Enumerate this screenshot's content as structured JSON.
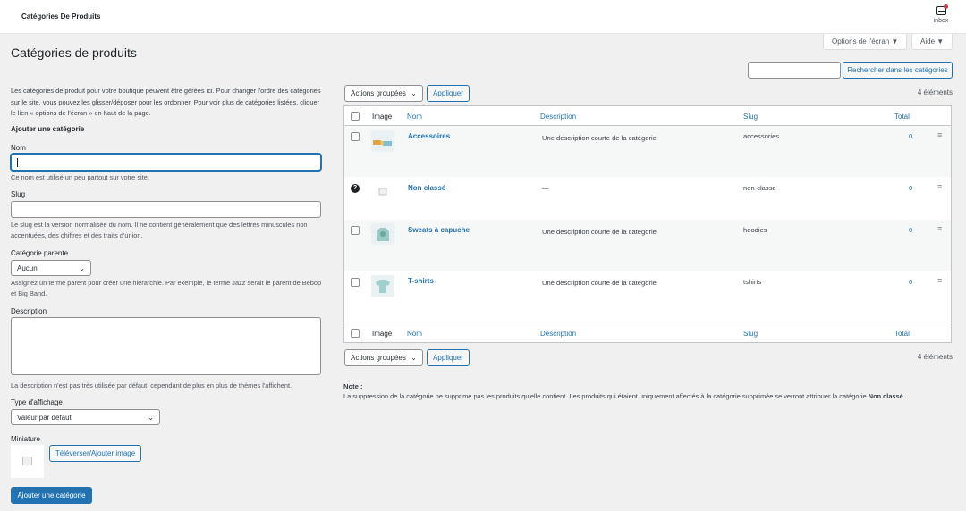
{
  "topbar": {
    "title": "Catégories De Produits",
    "inbox_label": "inbox"
  },
  "screen_options": {
    "label": "Options de l'écran ▼",
    "help_label": "Aide ▼"
  },
  "page": {
    "title": "Catégories de produits"
  },
  "search": {
    "button": "Rechercher dans les catégories",
    "value": ""
  },
  "form": {
    "intro": "Les catégories de produit pour votre boutique peuvent être gérées ici. Pour changer l'ordre des catégories sur le site, vous pouvez les glisser/déposer pour les ordonner. Pour voir plus de catégories listées, cliquer le lien « options de l'écran » en haut de la page.",
    "heading": "Ajouter une catégorie",
    "name_label": "Nom",
    "name_value": "",
    "name_help": "Ce nom est utilisé un peu partout sur votre site.",
    "slug_label": "Slug",
    "slug_value": "",
    "slug_help": "Le slug est la version normalisée du nom. Il ne contient généralement que des lettres minuscules non accentuées, des chiffres et des traits d'union.",
    "parent_label": "Catégorie parente",
    "parent_value": "Aucun",
    "parent_help": "Assignez un terme parent pour créer une hiérarchie. Par exemple, le terme Jazz serait le parent de Bebop et Big Band.",
    "description_label": "Description",
    "description_value": "",
    "description_help": "La description n'est pas très utilisée par défaut, cependant de plus en plus de thèmes l'affichent.",
    "display_label": "Type d'affichage",
    "display_value": "Valeur par défaut",
    "thumbnail_label": "Miniature",
    "upload_button": "Téléverser/Ajouter image",
    "submit_button": "Ajouter une catégorie"
  },
  "bulk": {
    "actions_label": "Actions groupées",
    "apply_label": "Appliquer",
    "count_text": "4 éléments"
  },
  "table": {
    "columns": {
      "image": "Image",
      "name": "Nom",
      "description": "Description",
      "slug": "Slug",
      "total": "Total"
    },
    "rows": [
      {
        "name": "Accessoires",
        "description": "Une description courte de la catégorie",
        "slug": "accessories",
        "count": "0"
      },
      {
        "name": "Non classé",
        "description": "—",
        "slug": "non-classe",
        "count": "0"
      },
      {
        "name": "Sweats à capuche",
        "description": "Une description courte de la catégorie",
        "slug": "hoodies",
        "count": "0"
      },
      {
        "name": "T-shirts",
        "description": "Une description courte de la catégorie",
        "slug": "tshirts",
        "count": "0"
      }
    ]
  },
  "note": {
    "title": "Note :",
    "text": "La suppression de la catégorie ne supprime pas les produits qu'elle contient. Les produits qui étaient uniquement affectés à la catégorie supprimée se verront attribuer la catégorie",
    "bold": "Non classé",
    "end": "."
  },
  "colors": {
    "accent": "#2271b1",
    "background": "#f0f0f1"
  }
}
